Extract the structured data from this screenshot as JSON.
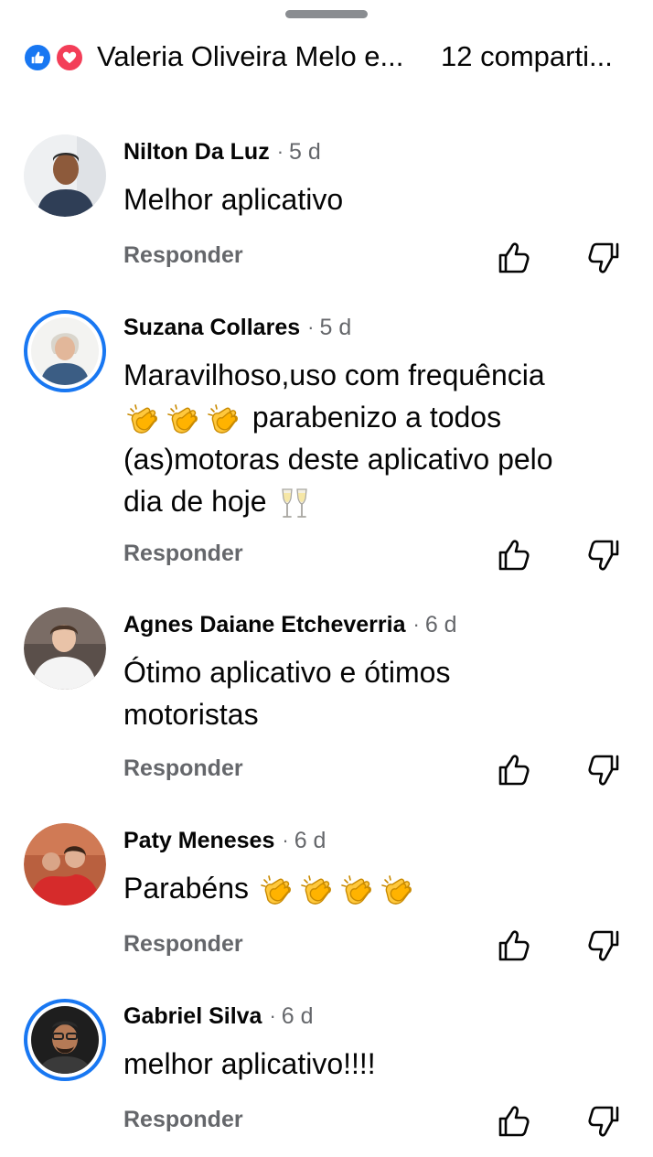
{
  "header": {
    "reactors": "Valeria Oliveira Melo e...",
    "shares": "12 comparti..."
  },
  "reaction_icons": [
    "like-icon",
    "love-icon"
  ],
  "reply_label": "Responder",
  "comments": [
    {
      "author": "Nilton Da Luz",
      "time": "5 d",
      "text": "Melhor aplicativo"
    },
    {
      "author": "Suzana Collares",
      "time": "5 d",
      "lines": [
        "Maravilhoso,uso com frequência",
        "parabenizo a todos",
        "(as)motoras deste aplicativo pelo",
        "dia de hoje"
      ]
    },
    {
      "author": "Agnes Daiane Etcheverria",
      "time": "6 d",
      "lines": [
        "Ótimo aplicativo e ótimos",
        "motoristas"
      ]
    },
    {
      "author": "Paty Meneses",
      "time": "6 d",
      "text": "Parabéns"
    },
    {
      "author": "Gabriel Silva",
      "time": "6 d",
      "text": "melhor aplicativo!!!!"
    }
  ],
  "colors": {
    "accent": "#1877f2",
    "love": "#f33e58",
    "muted": "#65676b"
  }
}
